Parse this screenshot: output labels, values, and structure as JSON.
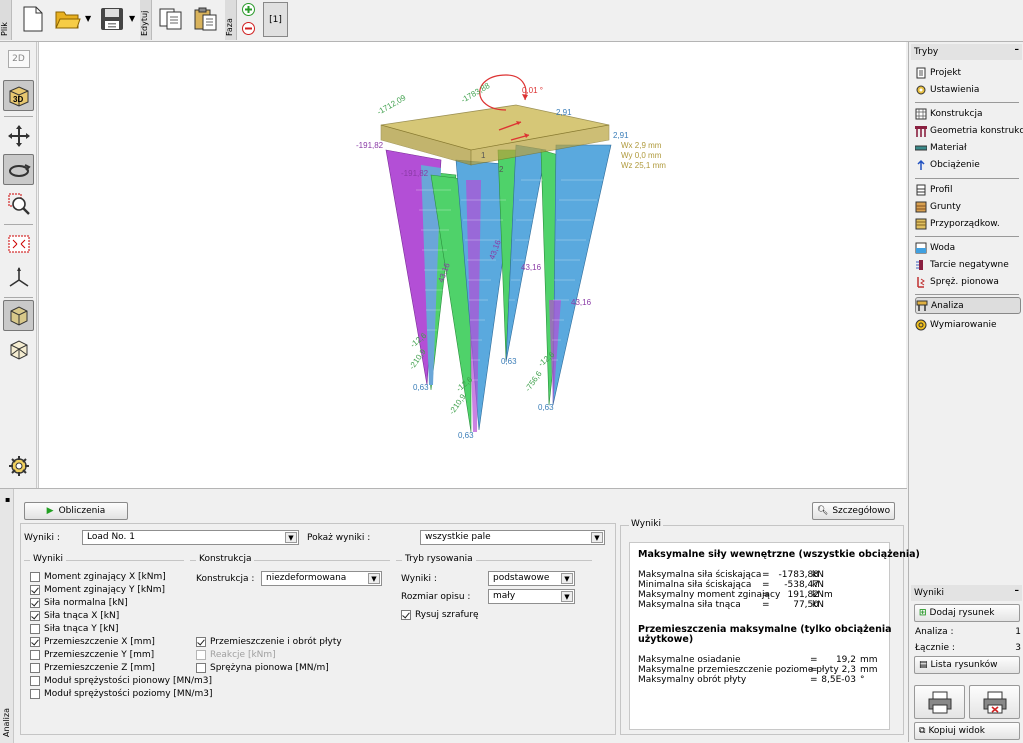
{
  "toolbar": {
    "tab_plik": "Plik",
    "tab_edytuj": "Edytuj",
    "tab_faza": "Faza",
    "phase_label": "[1]",
    "buttons": [
      "new-file",
      "open-file",
      "save-file",
      "copy",
      "paste"
    ]
  },
  "left_toolbar": {
    "btn_2d": "2D",
    "btn_3d": "3D"
  },
  "viewport": {
    "labels": {
      "rot": "0,01 °",
      "n1": "-1712,09",
      "n2": "-1783,88",
      "n3": "2,91",
      "n4": "2,91",
      "m1": "-191,82",
      "m2": "-191,82",
      "wx": "Wx 2,9 mm",
      "wy": "Wy 0,0 mm",
      "wz": "Wz 25,1 mm",
      "q1": "43,16",
      "q2": "43,16",
      "q3": "43,16",
      "q4": "43,16",
      "s1": "-12,6",
      "s2": "-210,9",
      "s3": "0,63",
      "s4": "-12,6",
      "s5": "-210,9",
      "s6": "0,63",
      "s7": "-12,6",
      "s8": "-756,6",
      "s9": "0,63",
      "s10": "0,63",
      "c1": "1",
      "c2": "2"
    }
  },
  "right_panel": {
    "tryby_title": "Tryby",
    "modes": [
      {
        "label": "Projekt"
      },
      {
        "label": "Ustawienia"
      },
      {
        "label": "Konstrukcja"
      },
      {
        "label": "Geometria konstrukcji"
      },
      {
        "label": "Materiał"
      },
      {
        "label": "Obciążenie"
      },
      {
        "label": "Profil"
      },
      {
        "label": "Grunty"
      },
      {
        "label": "Przyporządkow."
      },
      {
        "label": "Woda"
      },
      {
        "label": "Tarcie negatywne"
      },
      {
        "label": "Spręż. pionowa"
      },
      {
        "label": "Analiza"
      },
      {
        "label": "Wymiarowanie"
      }
    ],
    "wyniki_title": "Wyniki",
    "dodaj_rysunek": "Dodaj rysunek",
    "analiza_label": "Analiza :",
    "analiza_value": "1",
    "lacznie_label": "Łącznie :",
    "lacznie_value": "3",
    "lista_rysunkow": "Lista rysunków",
    "kopiuj_widok": "Kopiuj widok"
  },
  "bottom": {
    "side_tab": "Analiza",
    "obliczenia": "Obliczenia",
    "szczegolowo": "Szczegółowo",
    "wyniki_label": "Wyniki :",
    "wyniki_value": "Load No. 1",
    "pokaz_label": "Pokaż wyniki :",
    "pokaz_value": "wszystkie pale",
    "group_wyniki": "Wyniki",
    "group_konstrukcja": "Konstrukcja",
    "group_tryb": "Tryb rysowania",
    "checkboxes": [
      {
        "label": "Moment zginający X [kNm]",
        "checked": false
      },
      {
        "label": "Moment zginający Y [kNm]",
        "checked": true
      },
      {
        "label": "Siła normalna [kN]",
        "checked": true
      },
      {
        "label": "Siła tnąca X [kN]",
        "checked": true
      },
      {
        "label": "Siła tnąca Y [kN]",
        "checked": false
      },
      {
        "label": "Przemieszczenie X [mm]",
        "checked": true
      },
      {
        "label": "Przemieszczenie Y [mm]",
        "checked": false
      },
      {
        "label": "Przemieszczenie  Z [mm]",
        "checked": false
      },
      {
        "label": "Moduł sprężystości pionowy [MN/m3]",
        "checked": false
      },
      {
        "label": "Moduł sprężystości poziomy [MN/m3]",
        "checked": false
      }
    ],
    "konstrukcja_label": "Konstrukcja :",
    "konstrukcja_value": "niezdeformowana",
    "konstr_checks": [
      {
        "label": "Przemieszczenie i obrót płyty",
        "checked": true,
        "disabled": false
      },
      {
        "label": "Reakcje [kNm]",
        "checked": false,
        "disabled": true
      },
      {
        "label": "Sprężyna pionowa [MN/m]",
        "checked": false,
        "disabled": false
      }
    ],
    "tryb_wyniki_label": "Wyniki :",
    "tryb_wyniki_value": "podstawowe",
    "rozmiar_label": "Rozmiar opisu :",
    "rozmiar_value": "mały",
    "rysuj_szrafure": "Rysuj szrafurę",
    "rysuj_checked": true
  },
  "results": {
    "frame_title": "Wyniki",
    "title1": "Maksymalne siły wewnętrzne (wszystkie obciążenia)",
    "rows1": [
      {
        "name": "Maksymalna siła ściskająca",
        "eq": "=",
        "value": "-1783,88",
        "unit": "kN"
      },
      {
        "name": "Minimalna siła ściskająca",
        "eq": "=",
        "value": "-538,47",
        "unit": "kN"
      },
      {
        "name": "Maksymalny moment zginający",
        "eq": "=",
        "value": "191,82",
        "unit": "kNm"
      },
      {
        "name": "Maksymalna siła tnąca",
        "eq": "=",
        "value": "77,50",
        "unit": "kN"
      }
    ],
    "title2a": "Przemieszczenia maksymalne (tylko obciążenia",
    "title2b": "użytkowe)",
    "rows2": [
      {
        "name": "Maksymalne osiadanie",
        "eq": "=",
        "value": "19,2",
        "unit": "mm"
      },
      {
        "name": "Maksymalne przemieszczenie poziome płyty",
        "eq": "=",
        "value": "2,3",
        "unit": "mm"
      },
      {
        "name": "Maksymalny obrót płyty",
        "eq": "=",
        "value": "8,5E-03",
        "unit": "°"
      }
    ]
  }
}
